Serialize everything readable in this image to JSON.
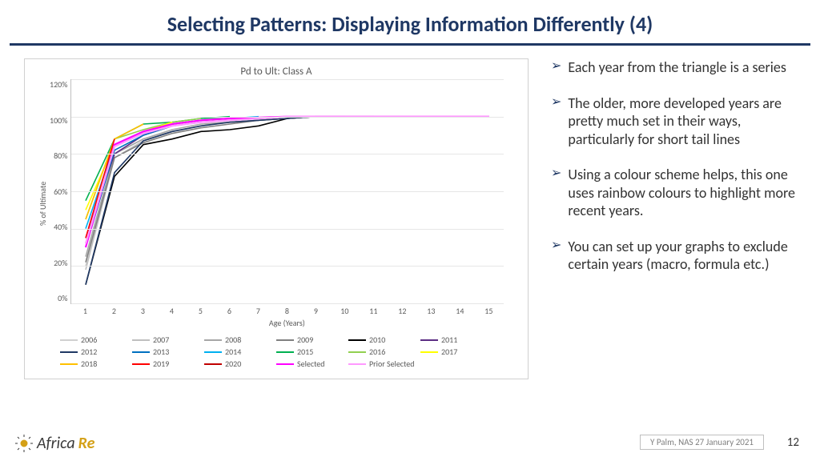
{
  "title": "Selecting Patterns: Displaying Information Differently (4)",
  "bullets": [
    "Each year from the triangle is a series",
    "The older, more developed years are pretty much set in their ways, particularly for short tail lines",
    "Using a colour scheme helps, this one uses rainbow colours to highlight more recent years.",
    "You can set up your graphs to exclude certain years (macro, formula etc.)"
  ],
  "footer": {
    "note": "Y Palm, NAS 27 January 2021",
    "page": "12"
  },
  "logo": {
    "text_a": "Africa",
    "text_b": "Re"
  },
  "chart_data": {
    "type": "line",
    "title": "Pd to Ult: Class A",
    "xlabel": "Age (Years)",
    "ylabel": "% of Ultimate",
    "x": [
      1,
      2,
      3,
      4,
      5,
      6,
      7,
      8,
      9,
      10,
      11,
      12,
      13,
      14,
      15
    ],
    "ylim": [
      0,
      120
    ],
    "yticks": [
      "0%",
      "20%",
      "40%",
      "60%",
      "80%",
      "100%",
      "120%"
    ],
    "series": [
      {
        "name": "2006",
        "color": "#d0d0d0",
        "values": [
          20,
          80,
          88,
          92,
          95,
          97,
          98,
          99,
          100,
          100,
          100,
          100,
          100,
          100,
          100
        ]
      },
      {
        "name": "2007",
        "color": "#bfbfbf",
        "values": [
          18,
          78,
          87,
          92,
          95,
          97,
          98,
          99,
          100,
          100,
          100,
          100,
          100,
          100
        ]
      },
      {
        "name": "2008",
        "color": "#a6a6a6",
        "values": [
          25,
          80,
          88,
          93,
          96,
          97,
          98,
          99,
          100,
          100,
          100,
          100,
          100
        ]
      },
      {
        "name": "2009",
        "color": "#808080",
        "values": [
          22,
          78,
          86,
          91,
          94,
          96,
          98,
          99,
          100,
          100,
          100,
          100
        ]
      },
      {
        "name": "2010",
        "color": "#000000",
        "values": [
          10,
          68,
          85,
          88,
          92,
          93,
          95,
          99,
          100,
          100,
          100
        ]
      },
      {
        "name": "2011",
        "color": "#5b2c83",
        "values": [
          35,
          80,
          90,
          95,
          97,
          98,
          99,
          100,
          100,
          100
        ]
      },
      {
        "name": "2012",
        "color": "#1f3864",
        "values": [
          10,
          70,
          87,
          92,
          95,
          97,
          98,
          99,
          100
        ]
      },
      {
        "name": "2013",
        "color": "#0070c0",
        "values": [
          30,
          82,
          90,
          95,
          97,
          98,
          99,
          100
        ]
      },
      {
        "name": "2014",
        "color": "#00b0f0",
        "values": [
          40,
          85,
          92,
          96,
          98,
          99,
          100
        ]
      },
      {
        "name": "2015",
        "color": "#00b050",
        "values": [
          55,
          88,
          96,
          97,
          99,
          100
        ]
      },
      {
        "name": "2016",
        "color": "#92d050",
        "values": [
          45,
          88,
          93,
          97,
          99
        ]
      },
      {
        "name": "2017",
        "color": "#ffff00",
        "values": [
          50,
          85,
          92,
          97
        ]
      },
      {
        "name": "2018",
        "color": "#ffc000",
        "values": [
          45,
          88,
          96
        ]
      },
      {
        "name": "2019",
        "color": "#ff0000",
        "values": [
          35,
          88
        ]
      },
      {
        "name": "2020",
        "color": "#c00000",
        "values": [
          15
        ]
      },
      {
        "name": "Selected",
        "color": "#ff00ff",
        "values": [
          30,
          85,
          92,
          96,
          98,
          99,
          99.5,
          100,
          100,
          100,
          100,
          100,
          100,
          100,
          100
        ]
      },
      {
        "name": "Prior Selected",
        "color": "#ff99ff",
        "values": [
          32,
          84,
          91,
          95,
          97,
          98,
          99,
          100,
          100,
          100,
          100,
          100,
          100,
          100,
          100
        ]
      }
    ]
  }
}
